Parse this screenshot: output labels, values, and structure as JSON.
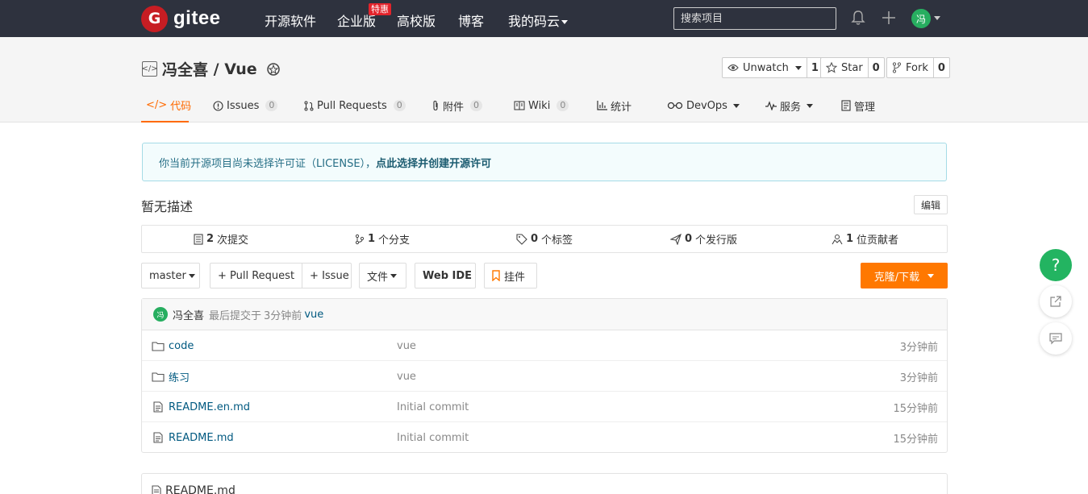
{
  "topnav": {
    "logo_letter": "G",
    "logo_text": "gitee",
    "links": [
      "开源软件",
      "企业版",
      "高校版",
      "博客",
      "我的码云"
    ],
    "hot_badge": "特惠",
    "search_placeholder": "搜索项目",
    "avatar_text": "冯"
  },
  "project": {
    "owner": "冯全喜",
    "separator": " / ",
    "name": "Vue",
    "watch": {
      "label": "Unwatch",
      "count": "1"
    },
    "star": {
      "label": "Star",
      "count": "0"
    },
    "fork": {
      "label": "Fork",
      "count": "0"
    }
  },
  "tabs": [
    {
      "label": "代码",
      "count": ""
    },
    {
      "label": "Issues",
      "count": "0"
    },
    {
      "label": "Pull Requests",
      "count": "0"
    },
    {
      "label": "附件",
      "count": "0"
    },
    {
      "label": "Wiki",
      "count": "0"
    },
    {
      "label": "统计",
      "count": ""
    },
    {
      "label": "DevOps",
      "count": ""
    },
    {
      "label": "服务",
      "count": ""
    },
    {
      "label": "管理",
      "count": ""
    }
  ],
  "notice": {
    "text": "你当前开源项目尚未选择许可证（LICENSE），",
    "link": "点此选择并创建开源许可"
  },
  "description": "暂无描述",
  "edit_label": "编辑",
  "stats": [
    {
      "count": "2",
      "label": "次提交"
    },
    {
      "count": "1",
      "label": "个分支"
    },
    {
      "count": "0",
      "label": "个标签"
    },
    {
      "count": "0",
      "label": "个发行版"
    },
    {
      "count": "1",
      "label": "位贡献者"
    }
  ],
  "toolbar": {
    "branch": "master",
    "pull_request": "+ Pull Request",
    "issue": "+ Issue",
    "file": "文件",
    "web_ide": "Web IDE",
    "widget": "挂件",
    "clone": "克隆/下载"
  },
  "last_commit": {
    "avatar": "冯",
    "author": "冯全喜",
    "text": "最后提交于",
    "time": "3分钟前",
    "message": "vue"
  },
  "files": [
    {
      "name": "code",
      "type": "folder",
      "message": "vue",
      "time": "3分钟前"
    },
    {
      "name": "练习",
      "type": "folder",
      "message": "vue",
      "time": "3分钟前"
    },
    {
      "name": "README.en.md",
      "type": "file",
      "message": "Initial commit",
      "time": "15分钟前"
    },
    {
      "name": "README.md",
      "type": "file",
      "message": "Initial commit",
      "time": "15分钟前"
    }
  ],
  "readme_title": "README.md",
  "float_help": "?"
}
